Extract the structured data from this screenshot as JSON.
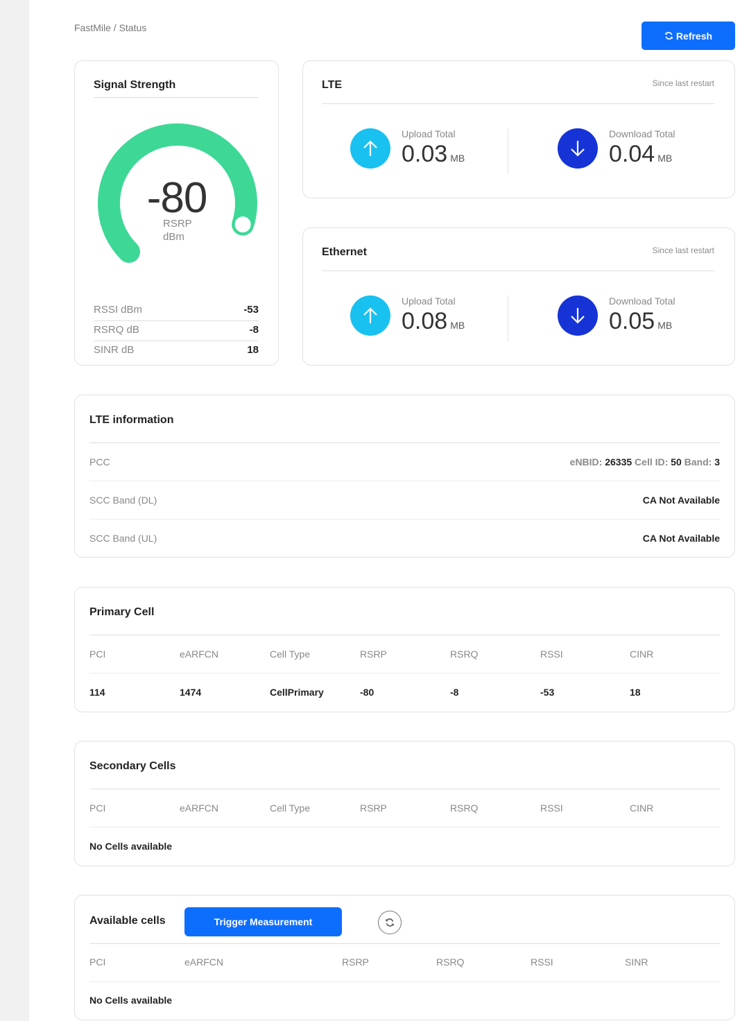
{
  "breadcrumb": "FastMile / Status",
  "refresh_label": "Refresh",
  "signal": {
    "title": "Signal Strength",
    "rsrp": "-80",
    "rsrp_label": "RSRP",
    "rsrp_unit": "dBm",
    "gauge_fraction": 0.9,
    "rows": [
      {
        "label": "RSSI dBm",
        "value": "-53"
      },
      {
        "label": "RSRQ dB",
        "value": "-8"
      },
      {
        "label": "SINR dB",
        "value": "18"
      }
    ]
  },
  "lte": {
    "title": "LTE",
    "since": "Since last restart",
    "upload_label": "Upload Total",
    "upload_value": "0.03",
    "upload_unit": "MB",
    "download_label": "Download Total",
    "download_value": "0.04",
    "download_unit": "MB"
  },
  "ethernet": {
    "title": "Ethernet",
    "since": "Since last restart",
    "upload_label": "Upload Total",
    "upload_value": "0.08",
    "upload_unit": "MB",
    "download_label": "Download Total",
    "download_value": "0.05",
    "download_unit": "MB"
  },
  "lte_info": {
    "title": "LTE information",
    "pcc_label": "PCC",
    "pcc_enbid_label": "eNBID:",
    "pcc_enbid": "26335",
    "pcc_cellid_label": "Cell ID:",
    "pcc_cellid": "50",
    "pcc_band_label": "Band:",
    "pcc_band": "3",
    "scc_dl_label": "SCC Band (DL)",
    "scc_dl_value": "CA Not Available",
    "scc_ul_label": "SCC Band (UL)",
    "scc_ul_value": "CA Not Available"
  },
  "primary_cell": {
    "title": "Primary Cell",
    "headers": [
      "PCI",
      "eARFCN",
      "Cell Type",
      "RSRP",
      "RSRQ",
      "RSSI",
      "CINR"
    ],
    "row": [
      "114",
      "1474",
      "CellPrimary",
      "-80",
      "-8",
      "-53",
      "18"
    ]
  },
  "secondary_cells": {
    "title": "Secondary Cells",
    "headers": [
      "PCI",
      "eARFCN",
      "Cell Type",
      "RSRP",
      "RSRQ",
      "RSSI",
      "CINR"
    ],
    "empty": "No Cells available"
  },
  "available_cells": {
    "title": "Available cells",
    "trigger_label": "Trigger Measurement",
    "headers": [
      "PCI",
      "eARFCN",
      "RSRP",
      "RSRQ",
      "RSSI",
      "SINR"
    ],
    "empty": "No Cells available"
  },
  "colors": {
    "accent": "#0d6efd",
    "gauge": "#3dd896",
    "upload_icon": "#19c1f0",
    "download_icon": "#1634d6"
  }
}
